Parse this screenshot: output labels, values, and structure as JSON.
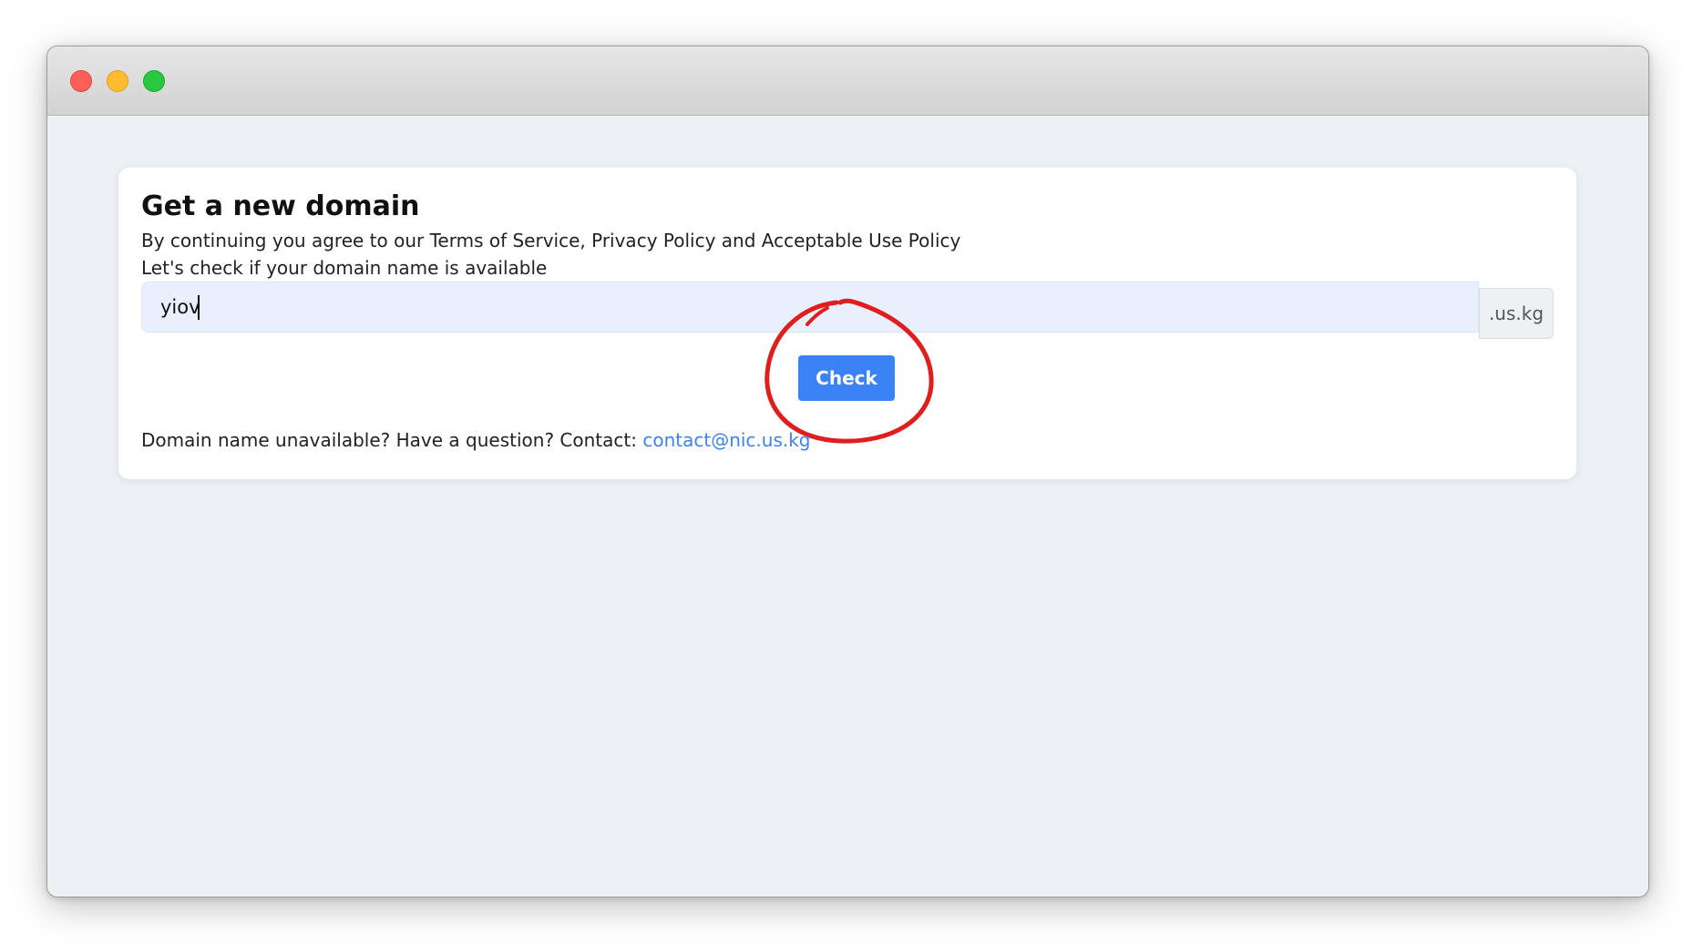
{
  "window": {
    "traffic_lights": [
      "close",
      "minimize",
      "maximize"
    ]
  },
  "card": {
    "title": "Get a new domain",
    "terms_text": "By continuing you agree to our Terms of Service, Privacy Policy and Acceptable Use Policy",
    "check_prompt": "Let's check if your domain name is available",
    "domain_input": {
      "value": "yiov",
      "placeholder": ""
    },
    "suffix": ".us.kg",
    "check_label": "Check",
    "contact_prefix": "Domain name unavailable? Have a question? Contact: ",
    "contact_email": "contact@nic.us.kg"
  },
  "colors": {
    "accent": "#3b82f6",
    "annotation": "#e11d1d",
    "input_bg": "#e8f0fe"
  }
}
